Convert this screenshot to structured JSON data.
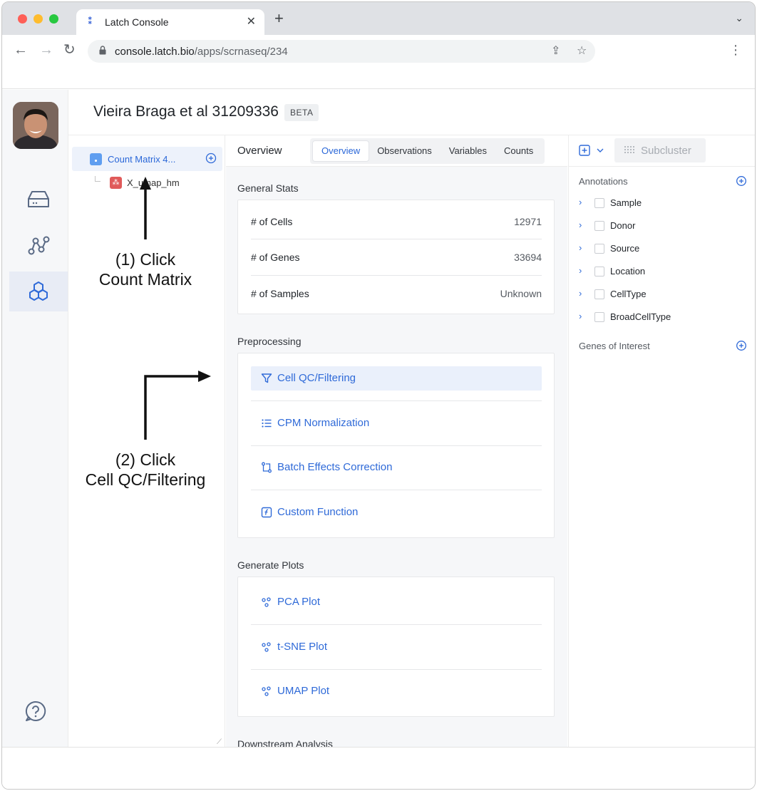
{
  "browser": {
    "tab_title": "Latch Console",
    "url_host": "console.latch.bio",
    "url_path": "/apps/scrnaseq/234"
  },
  "header": {
    "title": "Vieira Braga et al 31209336",
    "badge": "BETA"
  },
  "tree": {
    "root_label": "Count Matrix 4...",
    "child_label": "X_umap_hm"
  },
  "main": {
    "title": "Overview",
    "tabs": [
      "Overview",
      "Observations",
      "Variables",
      "Counts"
    ],
    "active_tab": "Overview",
    "general_stats_title": "General Stats",
    "stats": [
      {
        "label": "# of Cells",
        "value": "12971"
      },
      {
        "label": "# of Genes",
        "value": "33694"
      },
      {
        "label": "# of Samples",
        "value": "Unknown"
      }
    ],
    "preprocessing_title": "Preprocessing",
    "preprocessing": [
      {
        "label": "Cell QC/Filtering",
        "icon": "filter-icon"
      },
      {
        "label": "CPM Normalization",
        "icon": "list-icon"
      },
      {
        "label": "Batch Effects Correction",
        "icon": "merge-icon"
      },
      {
        "label": "Custom Function",
        "icon": "function-icon"
      }
    ],
    "plots_title": "Generate Plots",
    "plots": [
      {
        "label": "PCA Plot"
      },
      {
        "label": "t-SNE Plot"
      },
      {
        "label": "UMAP Plot"
      }
    ],
    "downstream_title": "Downstream Analysis"
  },
  "right": {
    "subcluster_label": "Subcluster",
    "annotations_title": "Annotations",
    "annotations": [
      "Sample",
      "Donor",
      "Source",
      "Location",
      "CellType",
      "BroadCellType"
    ],
    "genes_title": "Genes of Interest"
  },
  "overlay": {
    "step1_line1": "(1) Click",
    "step1_line2": "Count Matrix",
    "step2_line1": "(2) Click",
    "step2_line2": "Cell QC/Filtering"
  },
  "colors": {
    "accent": "#2f6ad8",
    "highlight": "#eaf0fb",
    "rail_bg": "#f6f7f9"
  }
}
